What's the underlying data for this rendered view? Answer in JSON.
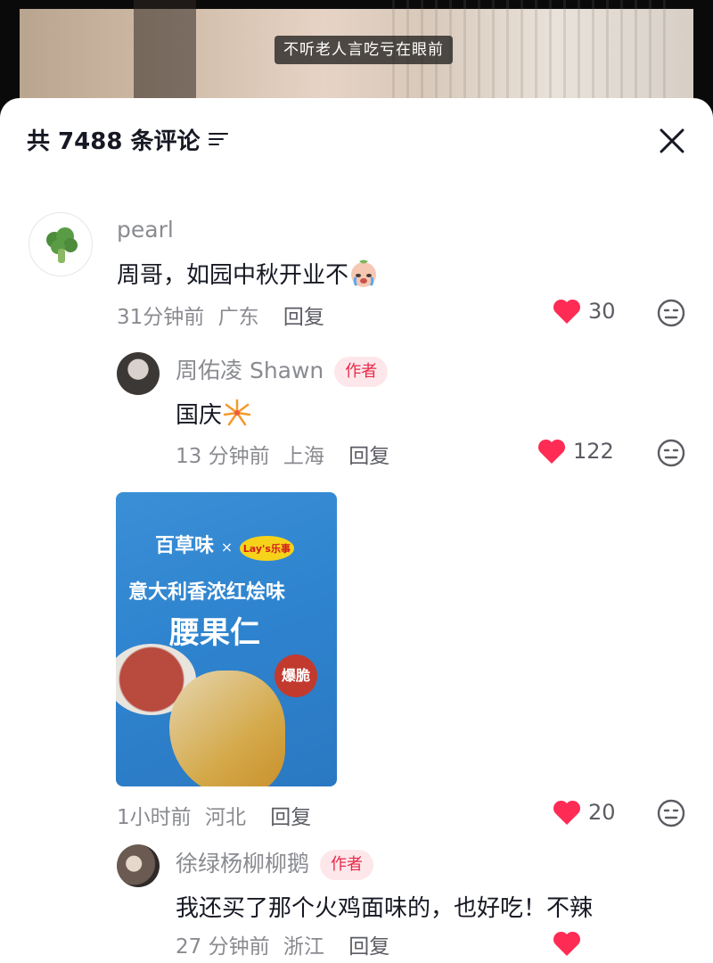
{
  "video": {
    "subtitle": "不听老人言吃亏在眼前"
  },
  "header": {
    "title": "共 7488 条评论"
  },
  "comments": [
    {
      "user": "pearl",
      "text": "周哥，如园中秋开业不",
      "time": "31分钟前",
      "location": "广东",
      "reply": "回复",
      "likes": "30"
    },
    {
      "user": "周佑凌 Shawn",
      "badge": "作者",
      "text": "国庆",
      "time": "13 分钟前",
      "location": "上海",
      "reply": "回复",
      "likes": "122"
    },
    {
      "image": {
        "brand_left": "百草味",
        "brand_x": "×",
        "brand_right": "Lay's乐事",
        "flavor": "意大利香浓红烩味",
        "product": "腰果仁",
        "tag": "爆脆"
      },
      "time": "1小时前",
      "location": "河北",
      "reply": "回复",
      "likes": "20"
    },
    {
      "user": "徐绿杨柳柳鹅",
      "badge": "作者",
      "text": "我还买了那个火鸡面味的，也好吃！不辣",
      "time": "27 分钟前",
      "location": "浙江",
      "reply": "回复"
    }
  ],
  "colors": {
    "like": "#fe2c55",
    "badge_bg": "#fde7ea",
    "badge_text": "#e8294a",
    "broccoli": "#4c8c3a"
  },
  "icons": [
    "filter-icon",
    "close-icon",
    "heart-icon",
    "dislike-face-icon",
    "crying-emoji-icon",
    "fireworks-emoji-icon",
    "broccoli-icon"
  ]
}
